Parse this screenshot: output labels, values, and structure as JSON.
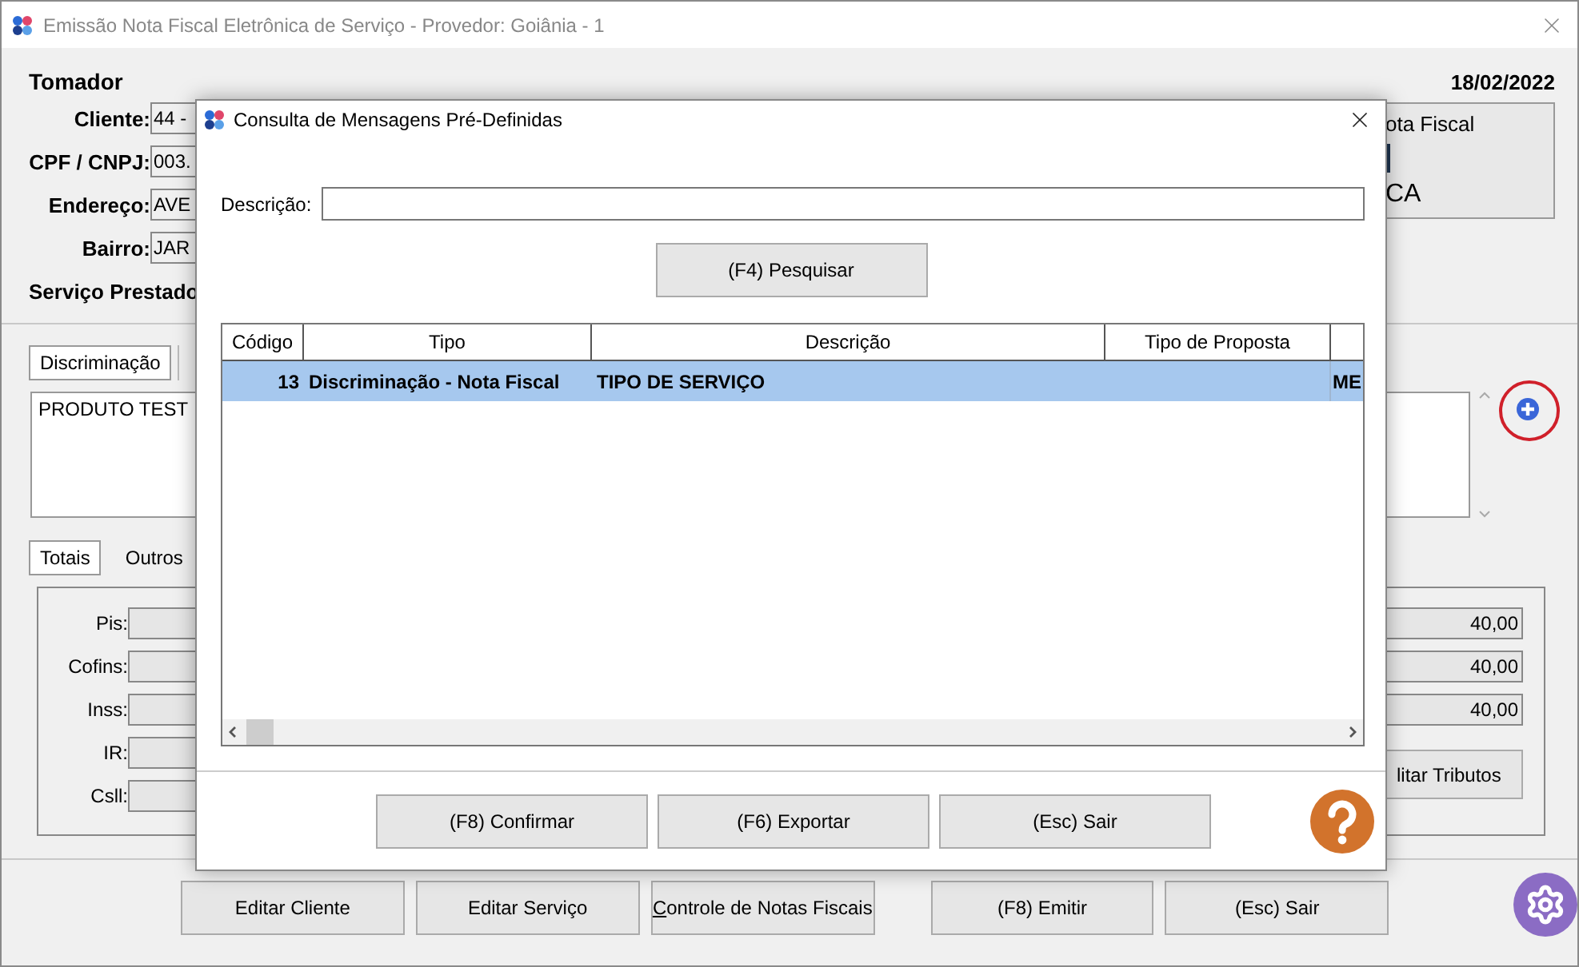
{
  "window": {
    "title": "Emissão Nota Fiscal Eletrônica de Serviço - Provedor: Goiânia - 1"
  },
  "tomador": {
    "heading": "Tomador",
    "date": "18/02/2022",
    "service_heading": "Serviço Prestado",
    "fields": [
      {
        "label": "Cliente:",
        "value": "44 -"
      },
      {
        "label": "CPF / CNPJ:",
        "value": "003."
      },
      {
        "label": "Endereço:",
        "value": "AVE"
      },
      {
        "label": "Bairro:",
        "value": "JAR"
      }
    ]
  },
  "note_box": {
    "line_1": "ota Fiscal",
    "line_3": "CA"
  },
  "text_tabs": [
    {
      "label": "Discriminação",
      "selected": true
    }
  ],
  "discriminacao": {
    "value": "PRODUTO TEST"
  },
  "totals_tabs": [
    {
      "label": "Totais",
      "selected": true
    },
    {
      "label": "Outros",
      "selected": false
    }
  ],
  "taxes": [
    {
      "label": "Pis:",
      "right_value": "40,00"
    },
    {
      "label": "Cofins:",
      "right_value": "40,00"
    },
    {
      "label": "Inss:",
      "right_value": "40,00"
    },
    {
      "label": "IR:"
    },
    {
      "label": "Csll:"
    }
  ],
  "edit_taxes_button": "litar Tributos",
  "bottom_buttons": [
    {
      "label": "Editar Cliente"
    },
    {
      "label": "Editar Serviço"
    },
    {
      "label": "Controle de Notas Fiscais",
      "underline_first": true
    },
    {
      "label": "(F8) Emitir"
    },
    {
      "label": "(Esc) Sair"
    }
  ],
  "dialog": {
    "title": "Consulta de Mensagens Pré-Definidas",
    "search_label": "Descrição:",
    "search_button": "(F4) Pesquisar",
    "table": {
      "columns": [
        "Código",
        "Tipo",
        "Descrição",
        "Tipo de Proposta"
      ],
      "rows": [
        {
          "cells": [
            "13",
            "Discriminação - Nota Fiscal",
            "TIPO DE SERVIÇO",
            "",
            "ME"
          ],
          "selected": true
        }
      ]
    },
    "buttons": [
      "(F8) Confirmar",
      "(F6) Exportar",
      "(Esc) Sair"
    ]
  }
}
